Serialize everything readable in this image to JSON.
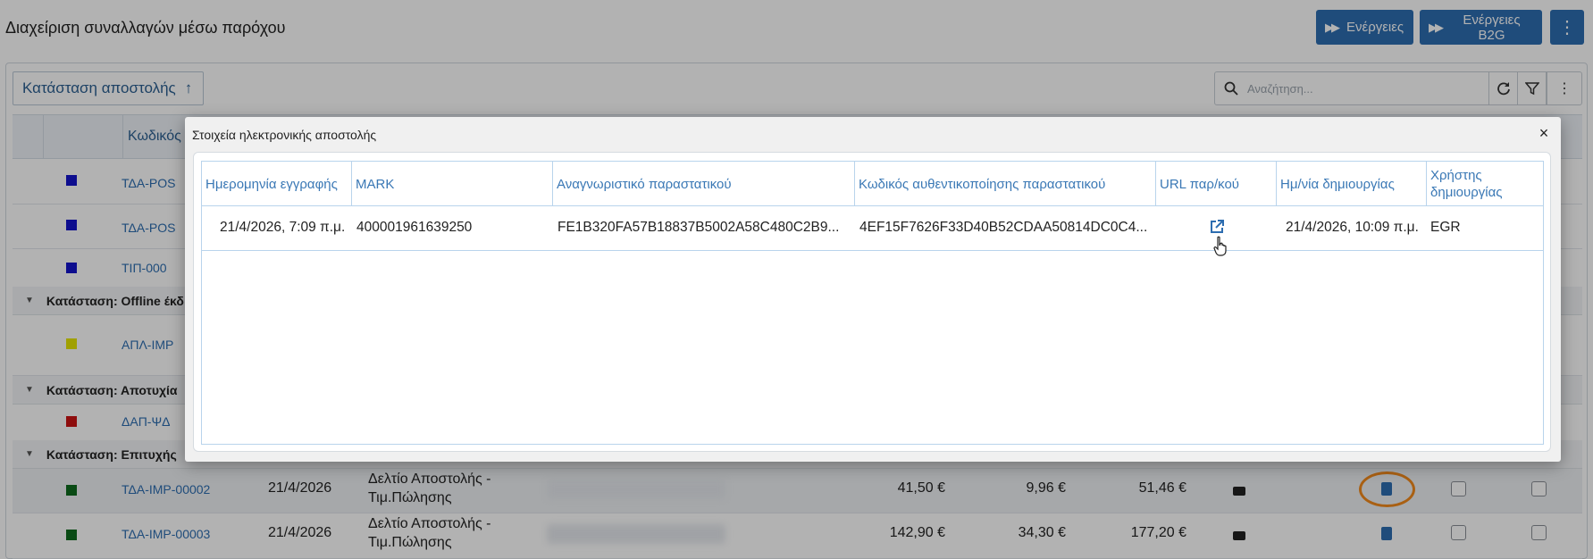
{
  "page": {
    "title": "Διαχείριση συναλλαγών μέσω παρόχου",
    "actions_label": "Ενέργειες",
    "actions_b2g_label": "Ενέργειες B2G",
    "more_label": "⋮"
  },
  "toolbar": {
    "sort_label": "Κατάσταση αποστολής",
    "search_placeholder": "Αναζήτηση..."
  },
  "grid": {
    "code_header": "Κωδικός",
    "rows_top": [
      {
        "code": "ΤΔΑ-POS",
        "color": "#1414cc"
      },
      {
        "code": "ΤΔΑ-POS",
        "color": "#1414cc"
      },
      {
        "code": "ΤΙΠ-000",
        "color": "#1414cc"
      }
    ],
    "group_offline": "Κατάσταση: Offline έκδ",
    "row_offline": {
      "code": "ΑΠΛ-ΙΜΡ",
      "color": "#e6e600"
    },
    "group_failed": "Κατάσταση: Αποτυχία",
    "row_failed": {
      "code": "ΔΑΠ-ΨΔ",
      "color": "#cc1414"
    },
    "group_success": "Κατάσταση: Επιτυχής",
    "rows_success": [
      {
        "code": "ΤΔΑ-ΙΜΡ-00002",
        "date": "21/4/2026",
        "type_line1": "Δελτίο Αποστολής -",
        "type_line2": "Τιμ.Πώλησης",
        "net": "41,50 €",
        "vat": "9,96 €",
        "total": "51,46 €",
        "color": "#0d6b1d"
      },
      {
        "code": "ΤΔΑ-ΙΜΡ-00003",
        "date": "21/4/2026",
        "type_line1": "Δελτίο Αποστολής -",
        "type_line2": "Τιμ.Πώλησης",
        "net": "142,90 €",
        "vat": "34,30 €",
        "total": "177,20 €",
        "color": "#0d6b1d"
      }
    ]
  },
  "modal": {
    "title": "Στοιχεία ηλεκτρονικής αποστολής",
    "close_label": "×",
    "headers": {
      "reg_date": "Ημερομηνία εγγραφής",
      "mark": "MARK",
      "doc_id": "Αναγνωριστικό παραστατικού",
      "auth_code": "Κωδικός αυθεντικοποίησης παραστατικού",
      "url": "URL παρ/κού",
      "created_date": "Ημ/νία δημιουργίας",
      "created_user": "Χρήστης δημιουργίας"
    },
    "row": {
      "reg_date": "21/4/2026, 7:09 π.μ.",
      "mark": "400001961639250",
      "doc_id": "FE1B320FA57B18837B5002A58C480C2B9...",
      "auth_code": "4EF15F7626F33D40B52CDAA50814DC0C4...",
      "created_date": "21/4/2026, 10:09 π.μ.",
      "created_user": "EGR"
    }
  }
}
